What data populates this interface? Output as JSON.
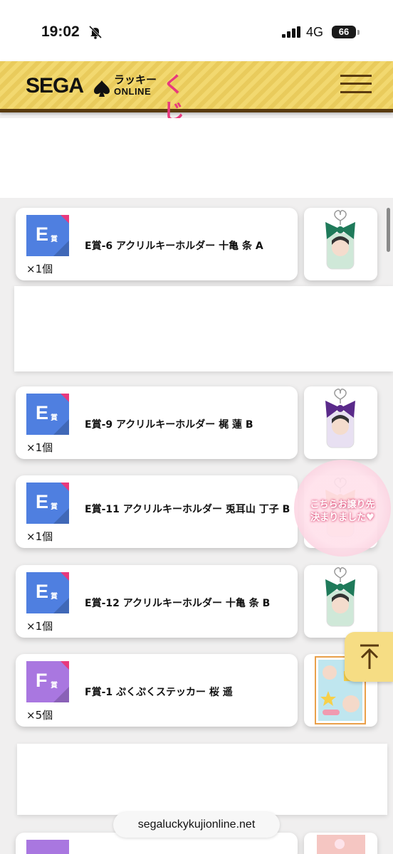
{
  "status_bar": {
    "time": "19:02",
    "network": "4G",
    "battery": "66"
  },
  "header": {
    "logo_sega": "SEGA",
    "logo_lucky": "ラッキー",
    "logo_online": "ONLINE",
    "logo_kuji": "くじ",
    "menu_icon": "hamburger-menu-icon"
  },
  "prizes": [
    {
      "grade": "E",
      "sho": "賞",
      "color": "#4f7fe0",
      "name": "E賞-6 アクリルキーホルダー 十亀 条 A",
      "quantity": "×1個",
      "thumb": "acrylic-keychain-green-bow"
    },
    {
      "grade": "E",
      "sho": "賞",
      "color": "#4f7fe0",
      "name": "E賞-9 アクリルキーホルダー 梶 蓮 B",
      "quantity": "×1個",
      "thumb": "acrylic-keychain-purple-bow"
    },
    {
      "grade": "E",
      "sho": "賞",
      "color": "#4f7fe0",
      "name": "E賞-11 アクリルキーホルダー 兎耳山 丁子 B",
      "quantity": "×1個",
      "thumb": "acrylic-keychain-orange-bow"
    },
    {
      "grade": "E",
      "sho": "賞",
      "color": "#4f7fe0",
      "name": "E賞-12 アクリルキーホルダー 十亀 条 B",
      "quantity": "×1個",
      "thumb": "acrylic-keychain-green-bow"
    },
    {
      "grade": "F",
      "sho": "賞",
      "color": "#a977e0",
      "name": "F賞-1 ぷくぷくステッカー 桜 遥",
      "quantity": "×5個",
      "thumb": "puffy-sticker-sheet"
    }
  ],
  "overlay_sticker": {
    "line1": "こちらお譲り先",
    "line2": "決まりました♥"
  },
  "back_to_top_icon": "arrow-up-icon",
  "url_bar": "segaluckykujionline.net"
}
